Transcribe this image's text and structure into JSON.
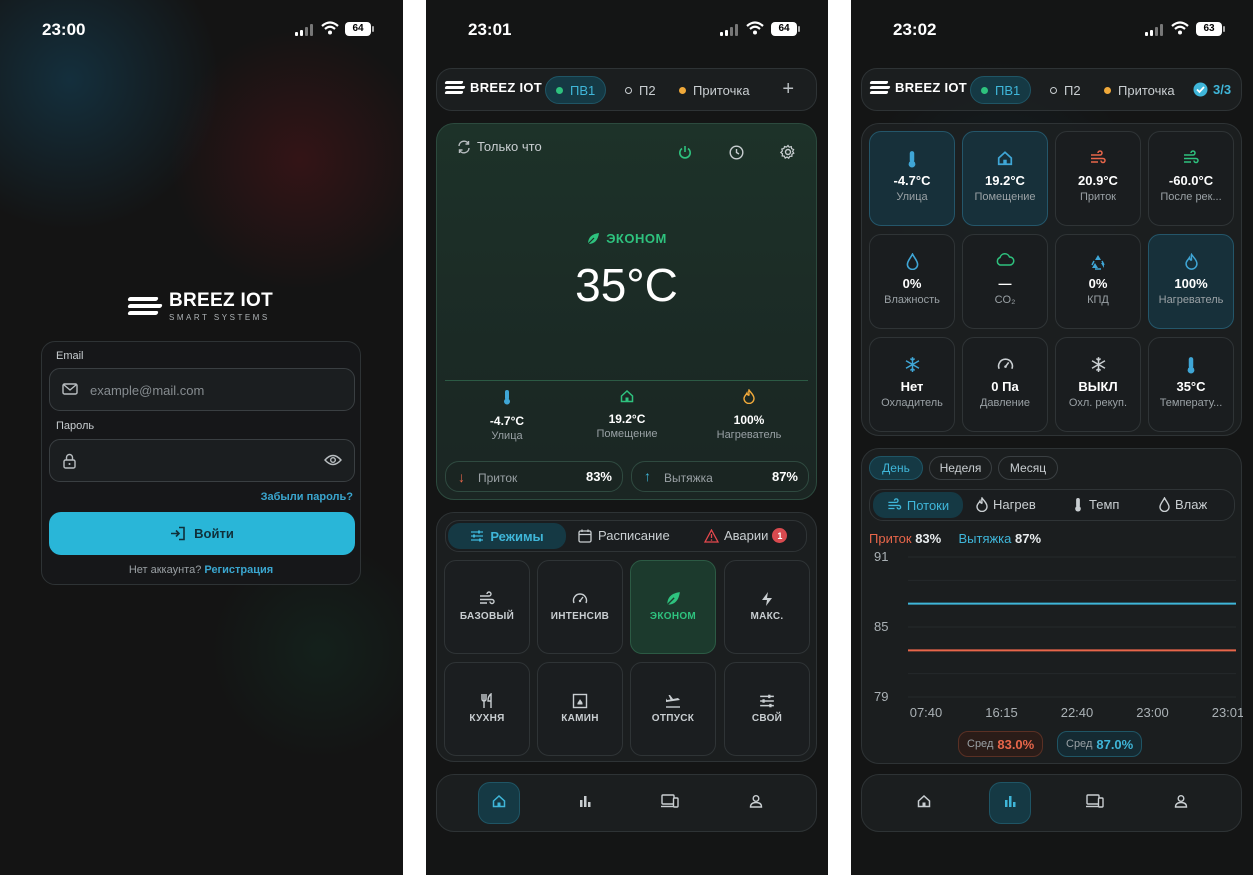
{
  "status_bars": [
    {
      "time": "23:00",
      "battery": "64"
    },
    {
      "time": "23:01",
      "battery": "64"
    },
    {
      "time": "23:02",
      "battery": "63"
    }
  ],
  "brand": {
    "name": "BREEZ IOT",
    "tagline": "SMART SYSTEMS"
  },
  "login": {
    "email_label": "Email",
    "email_placeholder": "example@mail.com",
    "password_label": "Пароль",
    "forgot": "Забыли пароль?",
    "login_button": "Войти",
    "no_account": "Нет аккаунта?",
    "register": "Регистрация"
  },
  "devices": [
    {
      "label": "ПВ1",
      "color": "#2ec27e",
      "active": true
    },
    {
      "label": "П2",
      "color": "#9aa0a4",
      "active": false
    },
    {
      "label": "Приточка",
      "color": "#f0a93a",
      "active": false
    }
  ],
  "device_counter": "3/3",
  "home": {
    "updated": "Только что",
    "mode": "ЭКОНОМ",
    "setpoint": "35°C",
    "sensors": [
      {
        "value": "-4.7°C",
        "name": "Улица",
        "icon": "thermometer-icon"
      },
      {
        "value": "19.2°C",
        "name": "Помещение",
        "icon": "home-icon"
      },
      {
        "value": "100%",
        "name": "Нагреватель",
        "icon": "flame-icon"
      }
    ],
    "supply": {
      "label": "Приток",
      "value": "83%"
    },
    "exhaust": {
      "label": "Вытяжка",
      "value": "87%"
    },
    "tabs": [
      {
        "label": "Режимы"
      },
      {
        "label": "Расписание"
      },
      {
        "label": "Аварии",
        "badge": "1"
      }
    ],
    "modes": [
      {
        "label": "БАЗОВЫЙ",
        "icon": "wind-icon"
      },
      {
        "label": "ИНТЕНСИВ",
        "icon": "gauge-icon"
      },
      {
        "label": "ЭКОНОМ",
        "icon": "leaf-icon",
        "active": true
      },
      {
        "label": "МАКС.",
        "icon": "bolt-icon"
      },
      {
        "label": "КУХНЯ",
        "icon": "cutlery-icon"
      },
      {
        "label": "КАМИН",
        "icon": "fireplace-icon"
      },
      {
        "label": "ОТПУСК",
        "icon": "plane-icon"
      },
      {
        "label": "СВОЙ",
        "icon": "sliders-icon"
      }
    ]
  },
  "metrics": [
    {
      "value": "-4.7°C",
      "name": "Улица",
      "icon": "thermometer-icon",
      "color": "#3fa6d6"
    },
    {
      "value": "19.2°C",
      "name": "Помещение",
      "icon": "home-icon",
      "color": "#3fa6d6"
    },
    {
      "value": "20.9°C",
      "name": "Приток",
      "icon": "wind-icon",
      "color": "#e8664a"
    },
    {
      "value": "-60.0°C",
      "name": "После рек...",
      "icon": "wind-icon",
      "color": "#2ec27e"
    },
    {
      "value": "0%",
      "name": "Влажность",
      "icon": "droplet-icon",
      "color": "#3fa6d6"
    },
    {
      "value": "—",
      "name": "CO₂",
      "icon": "cloud-icon",
      "color": "#2ec27e"
    },
    {
      "value": "0%",
      "name": "КПД",
      "icon": "recycle-icon",
      "color": "#3fa6d6"
    },
    {
      "value": "100%",
      "name": "Нагреватель",
      "icon": "flame-icon",
      "color": "#3fa6d6"
    },
    {
      "value": "Нет",
      "name": "Охладитель",
      "icon": "snowflake-icon",
      "color": "#3fa6d6"
    },
    {
      "value": "0 Па",
      "name": "Давление",
      "icon": "gauge-icon",
      "color": "#c9ced1"
    },
    {
      "value": "ВЫКЛ",
      "name": "Охл. рекуп.",
      "icon": "snowflake-icon",
      "color": "#c9ced1"
    },
    {
      "value": "35°C",
      "name": "Температу...",
      "icon": "thermometer-icon",
      "color": "#3fa6d6"
    }
  ],
  "periods": [
    "День",
    "Неделя",
    "Месяц"
  ],
  "chart_tabs": [
    "Потоки",
    "Нагрев",
    "Темп",
    "Влаж"
  ],
  "chart_data": {
    "type": "line",
    "x": [
      "07:40",
      "16:15",
      "22:40",
      "23:00",
      "23:01"
    ],
    "series": [
      {
        "name": "Приток",
        "values": [
          83,
          83,
          83,
          83,
          83
        ],
        "color": "#e8664a",
        "current": "83%",
        "avg_label": "Сред",
        "avg": "83.0%"
      },
      {
        "name": "Вытяжка",
        "values": [
          87,
          87,
          87,
          87,
          87
        ],
        "color": "#3fb6d9",
        "current": "87%",
        "avg_label": "Сред",
        "avg": "87.0%"
      }
    ],
    "ylim": [
      79,
      91
    ],
    "yticks": [
      "91",
      "85",
      "79"
    ]
  }
}
